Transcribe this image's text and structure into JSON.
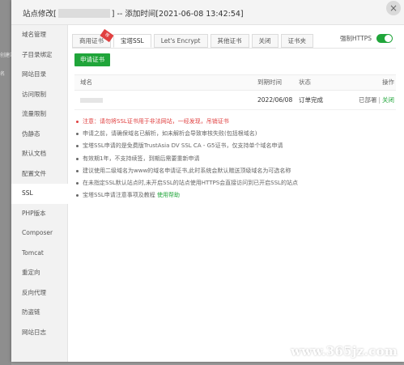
{
  "background": {
    "left_texts": [
      "创建站",
      "名"
    ]
  },
  "modal": {
    "title_prefix": "站点修改[",
    "title_suffix": "] -- 添加时间[2021-06-08 13:42:54]",
    "close_glyph": "×"
  },
  "sidebar": {
    "items": [
      {
        "label": "域名管理"
      },
      {
        "label": "子目录绑定"
      },
      {
        "label": "网站目录"
      },
      {
        "label": "访问限制"
      },
      {
        "label": "流量限制"
      },
      {
        "label": "伪静态"
      },
      {
        "label": "默认文档"
      },
      {
        "label": "配置文件"
      },
      {
        "label": "SSL"
      },
      {
        "label": "PHP版本"
      },
      {
        "label": "Composer"
      },
      {
        "label": "Tomcat"
      },
      {
        "label": "重定向"
      },
      {
        "label": "反向代理"
      },
      {
        "label": "防盗链"
      },
      {
        "label": "网站日志"
      }
    ],
    "active_index": 8
  },
  "tabs": [
    {
      "label": "商用证书",
      "ribbon": "荐"
    },
    {
      "label": "宝塔SSL"
    },
    {
      "label": "Let's Encrypt"
    },
    {
      "label": "其他证书"
    },
    {
      "label": "关闭"
    },
    {
      "label": "证书夹"
    }
  ],
  "active_tab": 1,
  "force_https": {
    "label": "强制HTTPS",
    "enabled": true
  },
  "apply_button": {
    "label": "申请证书"
  },
  "table": {
    "headers": {
      "domain": "域名",
      "expire": "到期时间",
      "status": "状态",
      "ops": "操作"
    },
    "rows": [
      {
        "expire": "2022/06/08",
        "status": "订单完成",
        "deployed": "已部署",
        "separator": "|",
        "close": "关闭"
      }
    ]
  },
  "notes": [
    {
      "text": "注意：请勿将SSL证书用于非法网站，一经发现，吊销证书",
      "warn": true
    },
    {
      "text": "申请之前，请确保域名已解析，如未解析会导致审核失败(包括根域名)"
    },
    {
      "text": "宝塔SSL申请的是免费版TrustAsia DV SSL CA - G5证书，仅支持单个域名申请"
    },
    {
      "text": "有效期1年，不支持续签，到期后需要重新申请"
    },
    {
      "text": "建议使用二级域名为www的域名申请证书,此时系统会默认赠送顶级域名为可选名称"
    },
    {
      "text": "在未指定SSL默认站点时,未开启SSL的站点使用HTTPS会直接访问到已开启SSL的站点"
    },
    {
      "text": "宝塔SSL申请注意事项及教程 ",
      "link": "使用帮助"
    }
  ],
  "watermark": "www.365jz.com",
  "colors": {
    "accent": "#20a53a",
    "warning": "#e04040"
  }
}
